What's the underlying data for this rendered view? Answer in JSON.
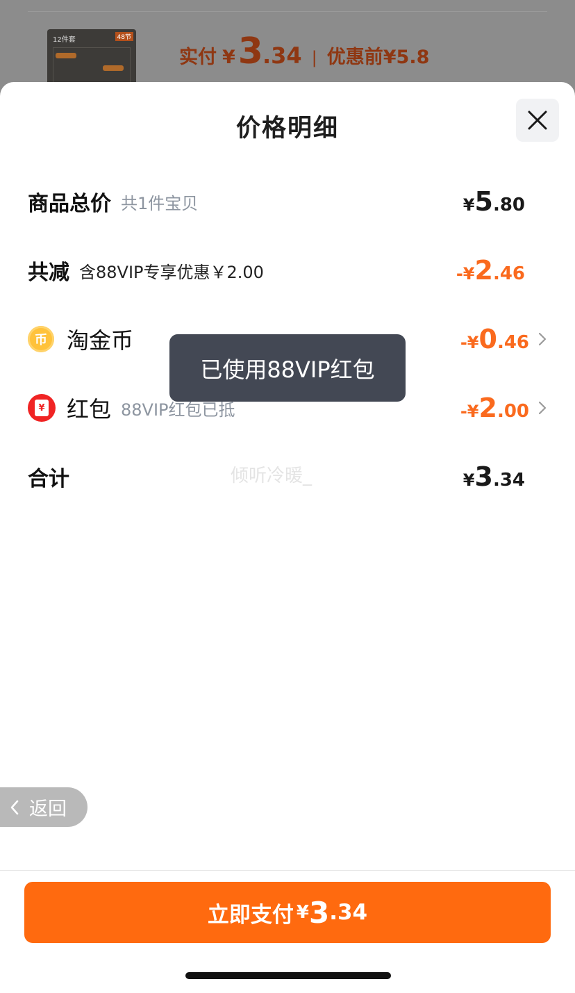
{
  "background": {
    "thumb_tag": "12件套",
    "thumb_badge": "48节",
    "paid_label": "实付",
    "currency": "¥",
    "paid_int": "3",
    "paid_dec": ".34",
    "separator": "|",
    "original_label": "优惠前¥5.8"
  },
  "sheet": {
    "title": "价格明细",
    "close_icon": "close-icon"
  },
  "rows": {
    "total": {
      "title": "商品总价",
      "sub": "共1件宝贝",
      "sign": "¥",
      "int": "5",
      "dec": ".80"
    },
    "discount": {
      "title": "共减",
      "sub": "含88VIP专享优惠￥2.00",
      "sign": "-¥",
      "int": "2",
      "dec": ".46"
    },
    "coin": {
      "title": "淘金币",
      "icon_text": "币",
      "sign": "-¥",
      "int": "0",
      "dec": ".46"
    },
    "redpacket": {
      "title": "红包",
      "sub": "88VIP红包已抵",
      "icon_text": "¥",
      "sign": "-¥",
      "int": "2",
      "dec": ".00"
    },
    "sum": {
      "title": "合计",
      "sign": "¥",
      "int": "3",
      "dec": ".34"
    }
  },
  "watermark": "倾听冷暖_",
  "toast": "已使用88VIP红包",
  "back_button": {
    "label": "返回"
  },
  "pay_button": {
    "label": "立即支付",
    "sign": "¥",
    "int": "3",
    "dec": ".34"
  },
  "colors": {
    "accent": "#ff6a0f",
    "discount": "#fa6a1e",
    "toast_bg": "#434854"
  }
}
